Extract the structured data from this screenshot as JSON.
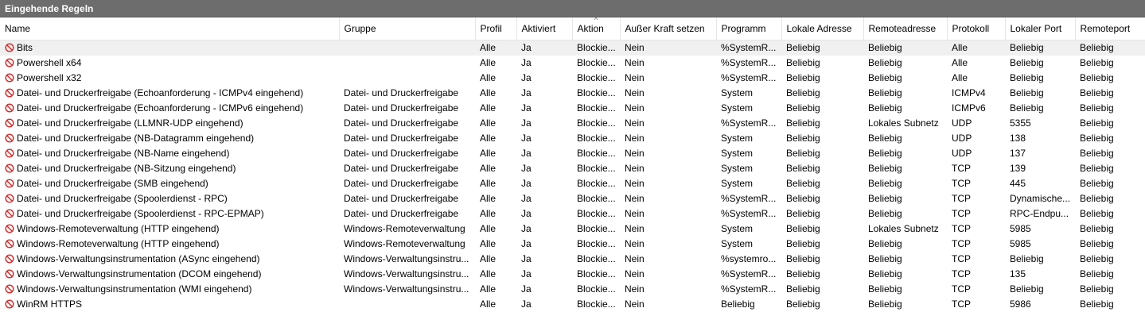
{
  "title": "Eingehende Regeln",
  "columns": [
    "Name",
    "Gruppe",
    "Profil",
    "Aktiviert",
    "Aktion",
    "Außer Kraft setzen",
    "Programm",
    "Lokale Adresse",
    "Remoteadresse",
    "Protokoll",
    "Lokaler Port",
    "Remoteport"
  ],
  "rows": [
    {
      "icon": "block-icon",
      "name": "Bits",
      "group": "",
      "profile": "Alle",
      "enabled": "Ja",
      "action": "Blockie...",
      "override": "Nein",
      "program": "%SystemR...",
      "local_address": "Beliebig",
      "remote_address": "Beliebig",
      "protocol": "Alle",
      "local_port": "Beliebig",
      "remote_port": "Beliebig"
    },
    {
      "icon": "block-icon",
      "name": "Powershell x64",
      "group": "",
      "profile": "Alle",
      "enabled": "Ja",
      "action": "Blockie...",
      "override": "Nein",
      "program": "%SystemR...",
      "local_address": "Beliebig",
      "remote_address": "Beliebig",
      "protocol": "Alle",
      "local_port": "Beliebig",
      "remote_port": "Beliebig"
    },
    {
      "icon": "block-icon",
      "name": "Powershell x32",
      "group": "",
      "profile": "Alle",
      "enabled": "Ja",
      "action": "Blockie...",
      "override": "Nein",
      "program": "%SystemR...",
      "local_address": "Beliebig",
      "remote_address": "Beliebig",
      "protocol": "Alle",
      "local_port": "Beliebig",
      "remote_port": "Beliebig"
    },
    {
      "icon": "block-icon",
      "name": "Datei- und Druckerfreigabe (Echoanforderung - ICMPv4 eingehend)",
      "group": "Datei- und Druckerfreigabe",
      "profile": "Alle",
      "enabled": "Ja",
      "action": "Blockie...",
      "override": "Nein",
      "program": "System",
      "local_address": "Beliebig",
      "remote_address": "Beliebig",
      "protocol": "ICMPv4",
      "local_port": "Beliebig",
      "remote_port": "Beliebig"
    },
    {
      "icon": "block-icon",
      "name": "Datei- und Druckerfreigabe (Echoanforderung - ICMPv6 eingehend)",
      "group": "Datei- und Druckerfreigabe",
      "profile": "Alle",
      "enabled": "Ja",
      "action": "Blockie...",
      "override": "Nein",
      "program": "System",
      "local_address": "Beliebig",
      "remote_address": "Beliebig",
      "protocol": "ICMPv6",
      "local_port": "Beliebig",
      "remote_port": "Beliebig"
    },
    {
      "icon": "block-icon",
      "name": "Datei- und Druckerfreigabe (LLMNR-UDP eingehend)",
      "group": "Datei- und Druckerfreigabe",
      "profile": "Alle",
      "enabled": "Ja",
      "action": "Blockie...",
      "override": "Nein",
      "program": "%SystemR...",
      "local_address": "Beliebig",
      "remote_address": "Lokales Subnetz",
      "protocol": "UDP",
      "local_port": "5355",
      "remote_port": "Beliebig"
    },
    {
      "icon": "block-icon",
      "name": "Datei- und Druckerfreigabe (NB-Datagramm eingehend)",
      "group": "Datei- und Druckerfreigabe",
      "profile": "Alle",
      "enabled": "Ja",
      "action": "Blockie...",
      "override": "Nein",
      "program": "System",
      "local_address": "Beliebig",
      "remote_address": "Beliebig",
      "protocol": "UDP",
      "local_port": "138",
      "remote_port": "Beliebig"
    },
    {
      "icon": "block-icon",
      "name": "Datei- und Druckerfreigabe (NB-Name eingehend)",
      "group": "Datei- und Druckerfreigabe",
      "profile": "Alle",
      "enabled": "Ja",
      "action": "Blockie...",
      "override": "Nein",
      "program": "System",
      "local_address": "Beliebig",
      "remote_address": "Beliebig",
      "protocol": "UDP",
      "local_port": "137",
      "remote_port": "Beliebig"
    },
    {
      "icon": "block-icon",
      "name": "Datei- und Druckerfreigabe (NB-Sitzung eingehend)",
      "group": "Datei- und Druckerfreigabe",
      "profile": "Alle",
      "enabled": "Ja",
      "action": "Blockie...",
      "override": "Nein",
      "program": "System",
      "local_address": "Beliebig",
      "remote_address": "Beliebig",
      "protocol": "TCP",
      "local_port": "139",
      "remote_port": "Beliebig"
    },
    {
      "icon": "block-icon",
      "name": "Datei- und Druckerfreigabe (SMB eingehend)",
      "group": "Datei- und Druckerfreigabe",
      "profile": "Alle",
      "enabled": "Ja",
      "action": "Blockie...",
      "override": "Nein",
      "program": "System",
      "local_address": "Beliebig",
      "remote_address": "Beliebig",
      "protocol": "TCP",
      "local_port": "445",
      "remote_port": "Beliebig"
    },
    {
      "icon": "block-icon",
      "name": "Datei- und Druckerfreigabe (Spoolerdienst - RPC)",
      "group": "Datei- und Druckerfreigabe",
      "profile": "Alle",
      "enabled": "Ja",
      "action": "Blockie...",
      "override": "Nein",
      "program": "%SystemR...",
      "local_address": "Beliebig",
      "remote_address": "Beliebig",
      "protocol": "TCP",
      "local_port": "Dynamische...",
      "remote_port": "Beliebig"
    },
    {
      "icon": "block-icon",
      "name": "Datei- und Druckerfreigabe (Spoolerdienst - RPC-EPMAP)",
      "group": "Datei- und Druckerfreigabe",
      "profile": "Alle",
      "enabled": "Ja",
      "action": "Blockie...",
      "override": "Nein",
      "program": "%SystemR...",
      "local_address": "Beliebig",
      "remote_address": "Beliebig",
      "protocol": "TCP",
      "local_port": "RPC-Endpu...",
      "remote_port": "Beliebig"
    },
    {
      "icon": "block-icon",
      "name": "Windows-Remoteverwaltung (HTTP eingehend)",
      "group": "Windows-Remoteverwaltung",
      "profile": "Alle",
      "enabled": "Ja",
      "action": "Blockie...",
      "override": "Nein",
      "program": "System",
      "local_address": "Beliebig",
      "remote_address": "Lokales Subnetz",
      "protocol": "TCP",
      "local_port": "5985",
      "remote_port": "Beliebig"
    },
    {
      "icon": "block-icon",
      "name": "Windows-Remoteverwaltung (HTTP eingehend)",
      "group": "Windows-Remoteverwaltung",
      "profile": "Alle",
      "enabled": "Ja",
      "action": "Blockie...",
      "override": "Nein",
      "program": "System",
      "local_address": "Beliebig",
      "remote_address": "Beliebig",
      "protocol": "TCP",
      "local_port": "5985",
      "remote_port": "Beliebig"
    },
    {
      "icon": "block-icon",
      "name": "Windows-Verwaltungsinstrumentation (ASync eingehend)",
      "group": "Windows-Verwaltungsinstru...",
      "profile": "Alle",
      "enabled": "Ja",
      "action": "Blockie...",
      "override": "Nein",
      "program": "%systemro...",
      "local_address": "Beliebig",
      "remote_address": "Beliebig",
      "protocol": "TCP",
      "local_port": "Beliebig",
      "remote_port": "Beliebig"
    },
    {
      "icon": "block-icon",
      "name": "Windows-Verwaltungsinstrumentation (DCOM eingehend)",
      "group": "Windows-Verwaltungsinstru...",
      "profile": "Alle",
      "enabled": "Ja",
      "action": "Blockie...",
      "override": "Nein",
      "program": "%SystemR...",
      "local_address": "Beliebig",
      "remote_address": "Beliebig",
      "protocol": "TCP",
      "local_port": "135",
      "remote_port": "Beliebig"
    },
    {
      "icon": "block-icon",
      "name": "Windows-Verwaltungsinstrumentation (WMI eingehend)",
      "group": "Windows-Verwaltungsinstru...",
      "profile": "Alle",
      "enabled": "Ja",
      "action": "Blockie...",
      "override": "Nein",
      "program": "%SystemR...",
      "local_address": "Beliebig",
      "remote_address": "Beliebig",
      "protocol": "TCP",
      "local_port": "Beliebig",
      "remote_port": "Beliebig"
    },
    {
      "icon": "block-icon",
      "name": "WinRM HTTPS",
      "group": "",
      "profile": "Alle",
      "enabled": "Ja",
      "action": "Blockie...",
      "override": "Nein",
      "program": "Beliebig",
      "local_address": "Beliebig",
      "remote_address": "Beliebig",
      "protocol": "TCP",
      "local_port": "5986",
      "remote_port": "Beliebig"
    }
  ]
}
